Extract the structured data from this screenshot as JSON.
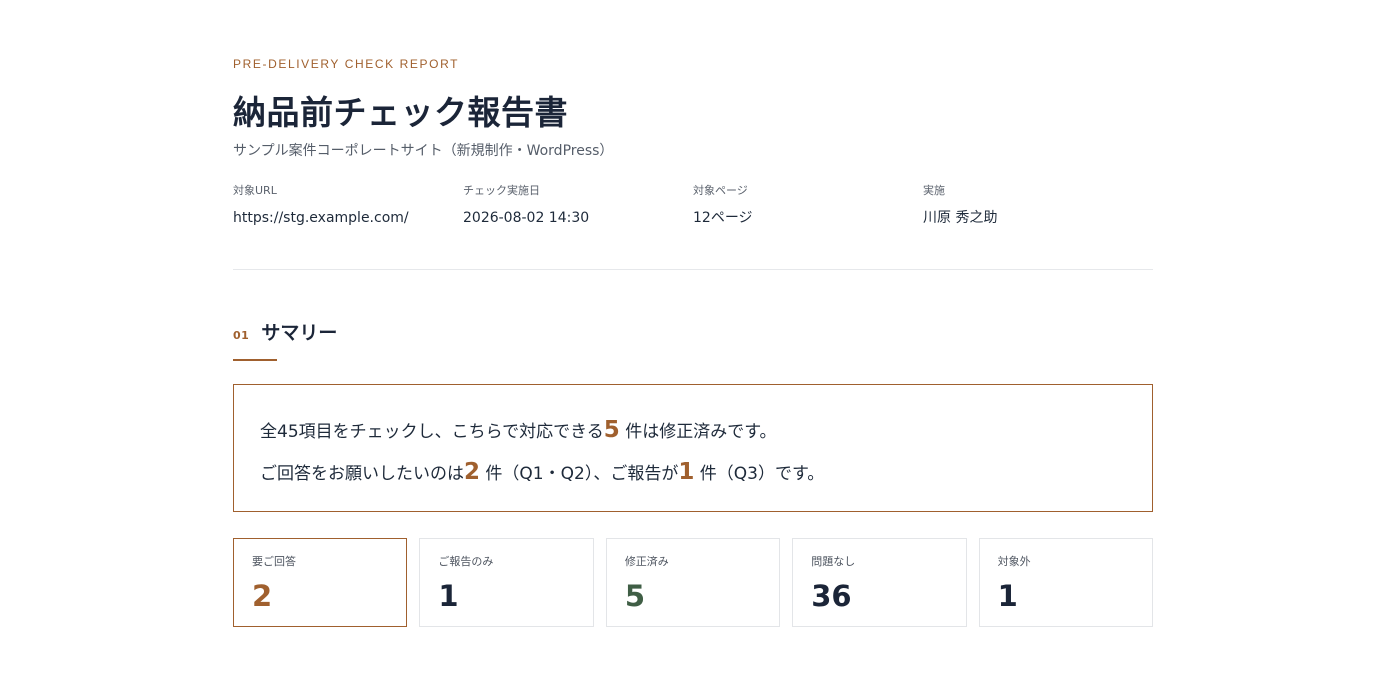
{
  "header": {
    "eyebrow": "PRE-DELIVERY CHECK REPORT",
    "title": "納品前チェック報告書",
    "subtitle": "サンプル案件コーポレートサイト（新規制作・WordPress）"
  },
  "meta": [
    {
      "label": "対象URL",
      "value": "https://stg.example.com/"
    },
    {
      "label": "チェック実施日",
      "value": "2026-08-02 14:30"
    },
    {
      "label": "対象ページ",
      "value": "12ページ"
    },
    {
      "label": "実施",
      "value": "川原 秀之助"
    }
  ],
  "section": {
    "number": "01",
    "title": "サマリー"
  },
  "summary": {
    "line1_a": "全45項目をチェックし、こちらで対応できる",
    "line1_num": "5",
    "line1_b": "件は修正済みです。",
    "line2_a": "ご回答をお願いしたいのは",
    "line2_num1": "2",
    "line2_b": "件（Q1・Q2）、ご報告が",
    "line2_num2": "1",
    "line2_c": "件（Q3）です。"
  },
  "cards": [
    {
      "label": "要ご回答",
      "value": "2",
      "color": "#a0602e"
    },
    {
      "label": "ご報告のみ",
      "value": "1",
      "color": "#1b2538"
    },
    {
      "label": "修正済み",
      "value": "5",
      "color": "#3f5e45"
    },
    {
      "label": "問題なし",
      "value": "36",
      "color": "#1b2538"
    },
    {
      "label": "対象外",
      "value": "1",
      "color": "#1b2538"
    }
  ],
  "colors": {
    "accent": "#a0602e",
    "text": "#1b2538",
    "fixed": "#3f5e45"
  }
}
